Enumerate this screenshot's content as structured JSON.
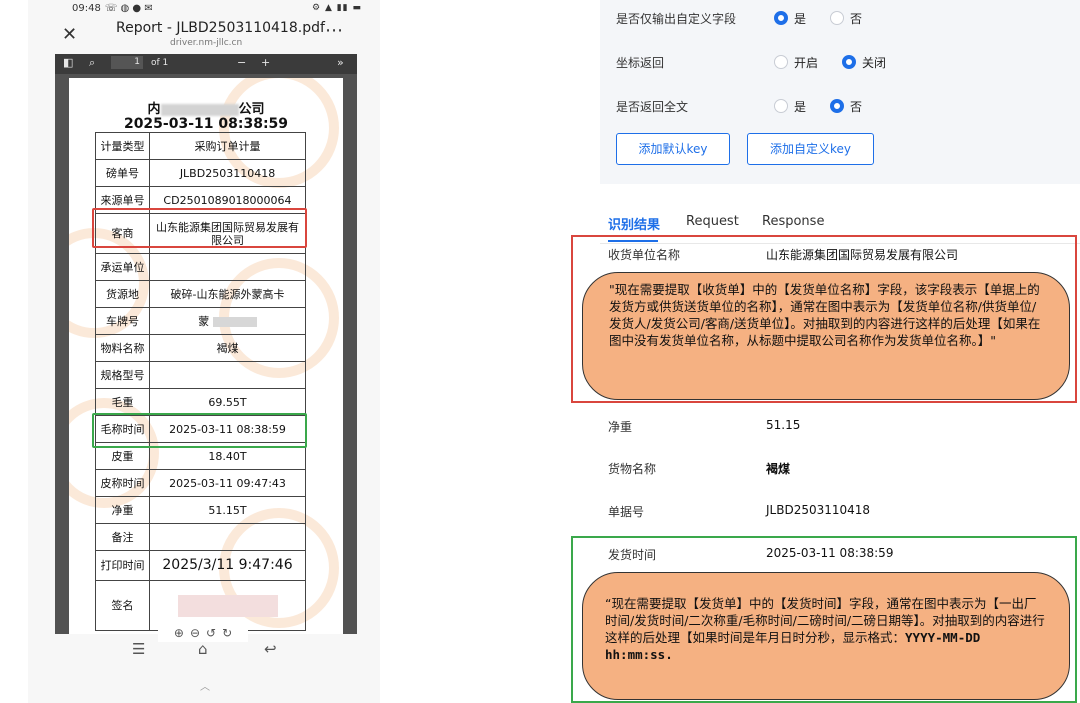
{
  "phone": {
    "status_time": "09:48",
    "doc_title": "Report - JLBD2503110418.pdf",
    "doc_url": "driver.nm-jllc.cn",
    "page_number": "1",
    "page_of": "of 1",
    "zoom_minus": "−",
    "zoom_plus": "+",
    "company_prefix": "内",
    "company_suffix": "公司",
    "header_datetime": "2025-03-11 08:38:59",
    "rows": [
      {
        "k": "计量类型",
        "v": "采购订单计量"
      },
      {
        "k": "磅单号",
        "v": "JLBD2503110418"
      },
      {
        "k": "来源单号",
        "v": "CD2501089018000064"
      },
      {
        "k": "客商",
        "v": "山东能源集团国际贸易发展有限公司"
      },
      {
        "k": "承运单位",
        "v": ""
      },
      {
        "k": "货源地",
        "v": "破碎-山东能源外蒙高卡"
      },
      {
        "k": "车牌号",
        "v": "蒙"
      },
      {
        "k": "物料名称",
        "v": "褐煤"
      },
      {
        "k": "规格型号",
        "v": ""
      },
      {
        "k": "毛重",
        "v": "69.55T"
      },
      {
        "k": "毛称时间",
        "v": "2025-03-11 08:38:59"
      },
      {
        "k": "皮重",
        "v": "18.40T"
      },
      {
        "k": "皮称时间",
        "v": "2025-03-11 09:47:43"
      },
      {
        "k": "净重",
        "v": "51.15T"
      },
      {
        "k": "备注",
        "v": ""
      },
      {
        "k": "打印时间",
        "v": "2025/3/11 9:47:46"
      },
      {
        "k": "签名",
        "v": ""
      }
    ]
  },
  "settings": {
    "custom_only": {
      "label": "是否仅输出自定义字段",
      "opt_yes": "是",
      "opt_no": "否"
    },
    "coord_return": {
      "label": "坐标返回",
      "opt_on": "开启",
      "opt_off": "关闭"
    },
    "full_text": {
      "label": "是否返回全文",
      "opt_yes": "是",
      "opt_no": "否"
    },
    "btn_default_key": "添加默认key",
    "btn_custom_key": "添加自定义key"
  },
  "tabs": [
    "识别结果",
    "Request",
    "Response"
  ],
  "results": {
    "receiver": {
      "label": "收货单位名称",
      "value": "山东能源集团国际贸易发展有限公司"
    },
    "net": {
      "label": "净重",
      "value": "51.15"
    },
    "goods": {
      "label": "货物名称",
      "value": "褐煤"
    },
    "doc_no": {
      "label": "单据号",
      "value": "JLBD2503110418"
    },
    "ship_time": {
      "label": "发货时间",
      "value": "2025-03-11 08:38:59"
    }
  },
  "notes": {
    "note1": "\"现在需要提取【收货单】中的【发货单位名称】字段，该字段表示【单据上的发货方或供货送货单位的名称】，通常在图中表示为【发货单位名称/供货单位/发货人/发货公司/客商/送货单位】。对抽取到的内容进行这样的后处理【如果在图中没有发货单位名称，从标题中提取公司名称作为发货单位名称。】\"",
    "note2_text": "“现在需要提取【发货单】中的【发货时间】字段，通常在图中表示为【一出厂时间/发货时间/二次称重/毛称时间/二磅时间/二磅日期等】。对抽取到的内容进行这样的后处理【如果时间是年月日时分秒，显示格式：",
    "note2_format": "YYYY-MM-DD hh:mm:ss."
  }
}
